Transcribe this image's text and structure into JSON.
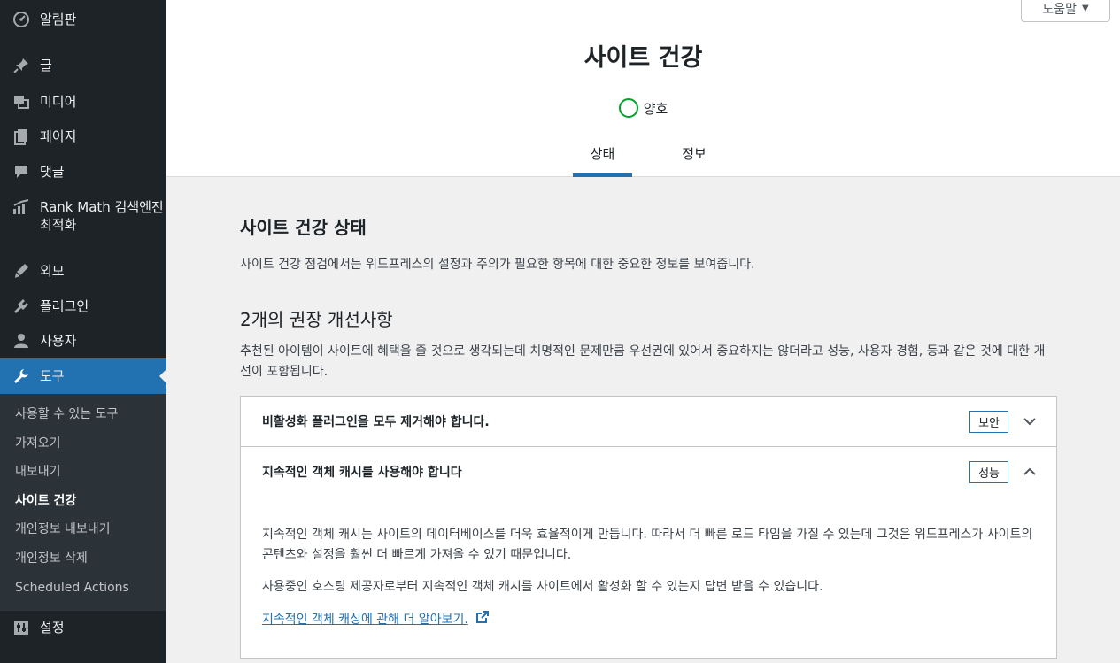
{
  "sidebar": {
    "items": [
      {
        "label": "알림판",
        "icon": "dashboard-icon"
      },
      {
        "label": "글",
        "icon": "pushpin-icon"
      },
      {
        "label": "미디어",
        "icon": "media-icon"
      },
      {
        "label": "페이지",
        "icon": "pages-icon"
      },
      {
        "label": "댓글",
        "icon": "comments-icon"
      },
      {
        "label": "Rank Math 검색엔진 최적화",
        "icon": "rank-math-icon"
      },
      {
        "label": "외모",
        "icon": "appearance-icon"
      },
      {
        "label": "플러그인",
        "icon": "plugins-icon"
      },
      {
        "label": "사용자",
        "icon": "users-icon"
      },
      {
        "label": "도구",
        "icon": "tools-icon"
      },
      {
        "label": "설정",
        "icon": "settings-icon"
      }
    ],
    "submenu": [
      {
        "label": "사용할 수 있는 도구"
      },
      {
        "label": "가져오기"
      },
      {
        "label": "내보내기"
      },
      {
        "label": "사이트 건강"
      },
      {
        "label": "개인정보 내보내기"
      },
      {
        "label": "개인정보 삭제"
      },
      {
        "label": "Scheduled Actions"
      }
    ]
  },
  "header": {
    "help_label": "도움말",
    "title": "사이트 건강",
    "status": "양호",
    "status_color": "#00a32a",
    "tabs": [
      {
        "label": "상태"
      },
      {
        "label": "정보"
      }
    ]
  },
  "main": {
    "section_title": "사이트 건강 상태",
    "description": "사이트 건강 점검에서는 워드프레스의 설정과 주의가 필요한 항목에 대한 중요한 정보를 보여줍니다.",
    "recommendations_heading": "2개의 권장 개선사항",
    "recommendations_desc": "추천된 아이템이 사이트에 혜택을 줄 것으로 생각되는데 치명적인 문제만큼 우선권에 있어서 중요하지는 않더라고 성능, 사용자 경험, 등과 같은 것에 대한 개선이 포함됩니다.",
    "items": [
      {
        "title": "비활성화 플러그인을 모두 제거해야 합니다.",
        "badge": "보안"
      },
      {
        "title": "지속적인 객체 캐시를 사용해야 합니다",
        "badge": "성능",
        "body_p1": "지속적인 객체 캐시는 사이트의 데이터베이스를 더욱 효율적이게 만듭니다. 따라서 더 빠른 로드 타임을 가질 수 있는데 그것은 워드프레스가 사이트의 콘텐츠와 설정을 훨씬 더 빠르게 가져올 수 있기 때문입니다.",
        "body_p2": "사용중인 호스팅 제공자로부터 지속적인 객체 캐시를 사이트에서 활성화 할 수 있는지 답변 받을 수 있습니다.",
        "link": "지속적인 객체 캐싱에 관해 더 알아보기."
      }
    ]
  },
  "colors": {
    "accent": "#2271b1",
    "sidebar_bg": "#1d2327",
    "submenu_bg": "#2c3338"
  }
}
